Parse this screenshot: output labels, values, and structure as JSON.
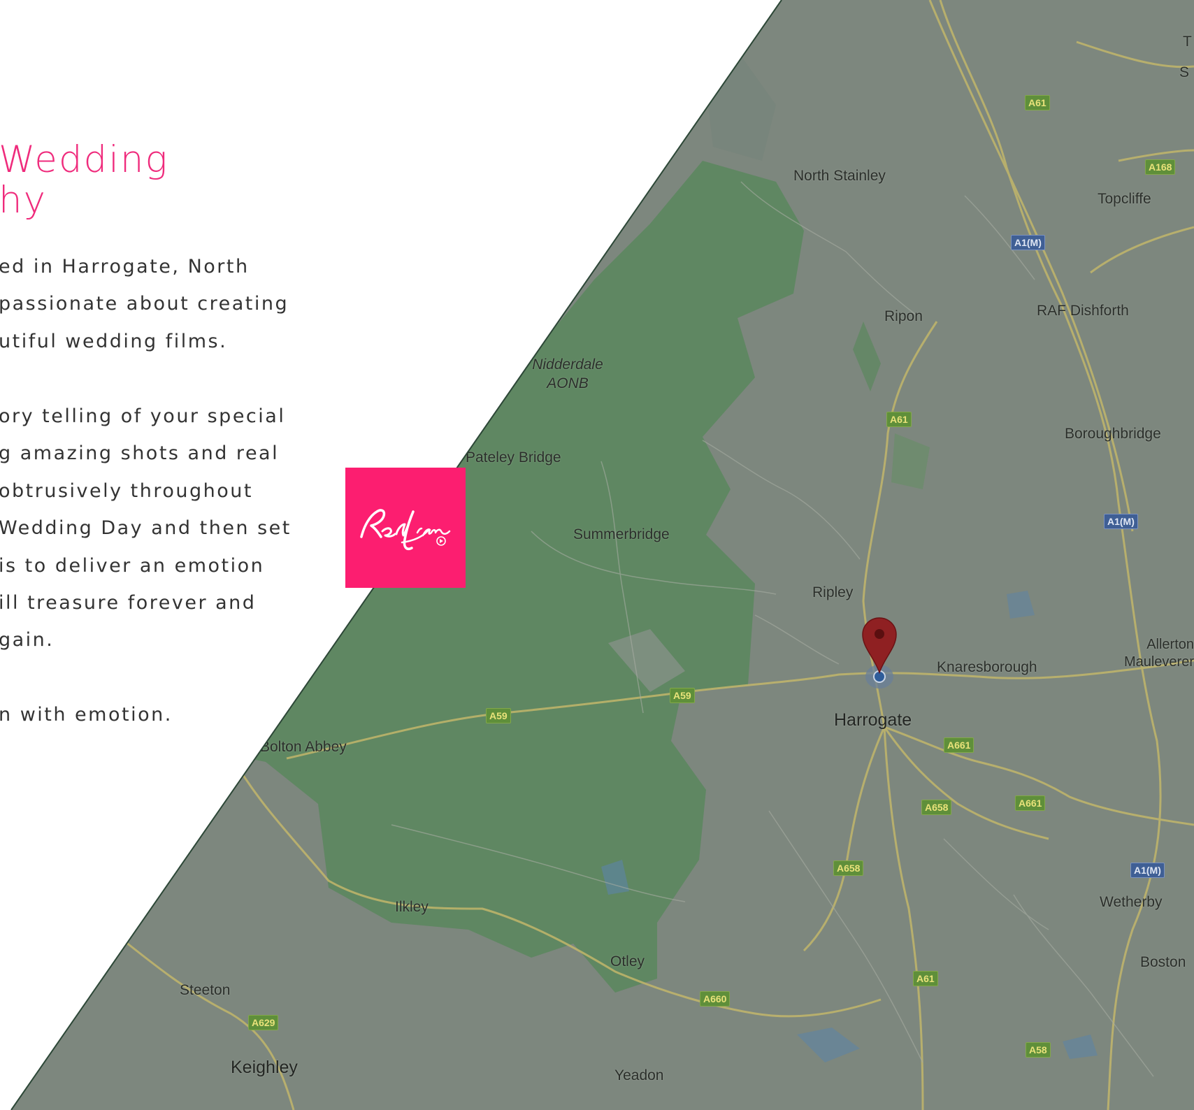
{
  "intro": {
    "heading_lines": [
      "Wedding",
      "hy"
    ],
    "paragraph_1": [
      "ed in Harrogate, North",
      "passionate about creating",
      "utiful wedding films."
    ],
    "paragraph_2": [
      "ory telling of your special",
      "g amazing shots and real",
      "obtrusively throughout",
      "Wedding Day and then set",
      "is to deliver an emotion",
      "ill treasure forever and",
      "gain."
    ],
    "paragraph_3": [
      "n with emotion."
    ]
  },
  "logo": {
    "text": "RedLime",
    "color": "#fc1e70"
  },
  "map": {
    "marker": "map-pin-icon",
    "places": {
      "north_stainley": "North Stainley",
      "topcliffe": "Topcliffe",
      "ripon": "Ripon",
      "raf_dishforth": "RAF Dishforth",
      "nidderdale_1": "Nidderdale",
      "nidderdale_2": "AONB",
      "boroughbridge": "Boroughbridge",
      "pateley_bridge": "Pateley Bridge",
      "summerbridge": "Summerbridge",
      "ripley": "Ripley",
      "allerton_1": "Allerton",
      "allerton_2": "Mauleverer",
      "knaresborough": "Knaresborough",
      "harrogate": "Harrogate",
      "bolton_abbey": "Bolton Abbey",
      "wetherby": "Wetherby",
      "ilkley": "Ilkley",
      "boston": "Boston",
      "otley": "Otley",
      "steeton": "Steeton",
      "keighley": "Keighley",
      "yeadon": "Yeadon",
      "edge_t": "T",
      "edge_s": "S"
    },
    "roads": {
      "a61_top": "A61",
      "a168": "A168",
      "a1m_1": "A1(M)",
      "a61_mid": "A61",
      "a1m_2": "A1(M)",
      "a59_east": "A59",
      "a59_west": "A59",
      "a661_1": "A661",
      "a658_1": "A658",
      "a661_2": "A661",
      "a658_2": "A658",
      "a1m_3": "A1(M)",
      "a61_low": "A61",
      "a660": "A660",
      "a629": "A629",
      "a58": "A58"
    }
  }
}
